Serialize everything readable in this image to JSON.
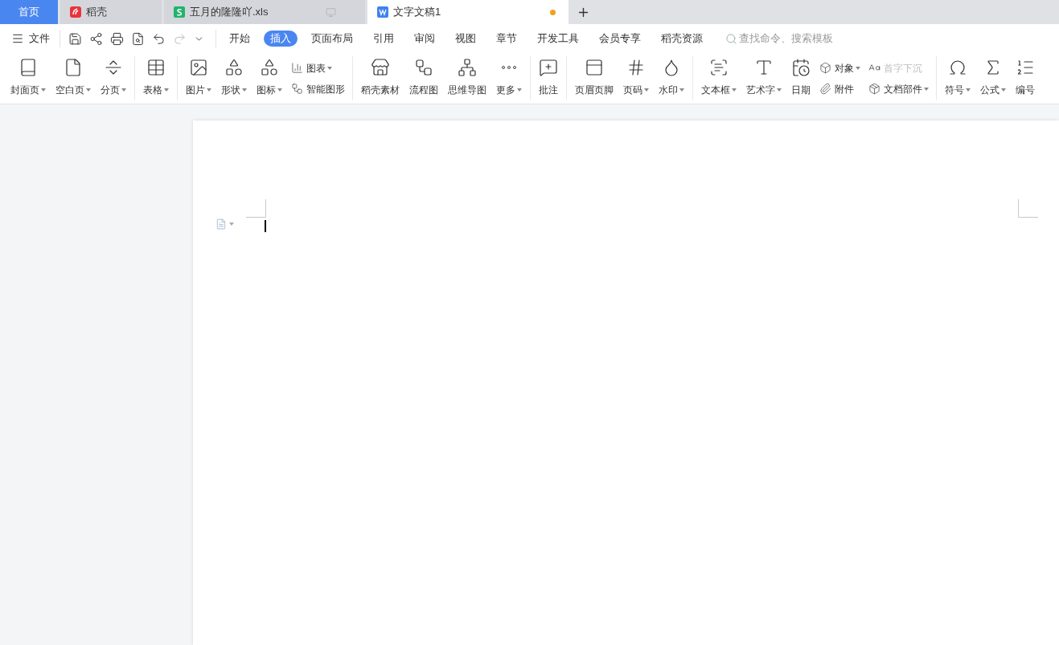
{
  "tabs": [
    {
      "label": "首页",
      "kind": "home",
      "selected": false,
      "unsaved": false
    },
    {
      "label": "稻壳",
      "kind": "docer",
      "selected": false,
      "unsaved": false
    },
    {
      "label": "五月的隆隆吖.xls",
      "kind": "sheet",
      "selected": false,
      "unsaved": false
    },
    {
      "label": "文字文稿1",
      "kind": "writer",
      "selected": true,
      "unsaved": true
    }
  ],
  "menu": {
    "file": "文件",
    "ribbon_tabs": [
      {
        "label": "开始",
        "selected": false
      },
      {
        "label": "插入",
        "selected": true
      },
      {
        "label": "页面布局",
        "selected": false
      },
      {
        "label": "引用",
        "selected": false
      },
      {
        "label": "审阅",
        "selected": false
      },
      {
        "label": "视图",
        "selected": false
      },
      {
        "label": "章节",
        "selected": false
      },
      {
        "label": "开发工具",
        "selected": false
      },
      {
        "label": "会员专享",
        "selected": false
      },
      {
        "label": "稻壳资源",
        "selected": false
      }
    ],
    "search": {
      "placeholder": "查找命令、搜索模板"
    }
  },
  "ribbon_groups": [
    [
      {
        "kind": "large",
        "label": "封面页",
        "dropdown": true
      },
      {
        "kind": "large",
        "label": "空白页",
        "dropdown": true
      },
      {
        "kind": "large",
        "label": "分页",
        "dropdown": true
      }
    ],
    [
      {
        "kind": "large",
        "label": "表格",
        "dropdown": true
      }
    ],
    [
      {
        "kind": "large",
        "label": "图片",
        "dropdown": true
      },
      {
        "kind": "large",
        "label": "形状",
        "dropdown": true
      },
      {
        "kind": "large",
        "label": "图标",
        "dropdown": true
      },
      {
        "kind": "stack",
        "items": [
          {
            "label": "图表",
            "dropdown": true,
            "disabled": false
          },
          {
            "label": "智能图形",
            "dropdown": false,
            "disabled": false
          }
        ]
      }
    ],
    [
      {
        "kind": "large",
        "label": "稻壳素材",
        "dropdown": false
      },
      {
        "kind": "large",
        "label": "流程图",
        "dropdown": false
      },
      {
        "kind": "large",
        "label": "思维导图",
        "dropdown": false
      },
      {
        "kind": "large",
        "label": "更多",
        "dropdown": true
      }
    ],
    [
      {
        "kind": "large",
        "label": "批注",
        "dropdown": false
      }
    ],
    [
      {
        "kind": "large",
        "label": "页眉页脚",
        "dropdown": false
      },
      {
        "kind": "large",
        "label": "页码",
        "dropdown": true
      },
      {
        "kind": "large",
        "label": "水印",
        "dropdown": true
      }
    ],
    [
      {
        "kind": "large",
        "label": "文本框",
        "dropdown": true
      },
      {
        "kind": "large",
        "label": "艺术字",
        "dropdown": true
      },
      {
        "kind": "large",
        "label": "日期",
        "dropdown": false
      },
      {
        "kind": "stack",
        "items": [
          {
            "label": "对象",
            "dropdown": true,
            "disabled": false
          },
          {
            "label": "附件",
            "dropdown": false,
            "disabled": false
          }
        ]
      },
      {
        "kind": "stack",
        "items": [
          {
            "label": "首字下沉",
            "dropdown": false,
            "disabled": true
          },
          {
            "label": "文档部件",
            "dropdown": true,
            "disabled": false
          }
        ]
      }
    ],
    [
      {
        "kind": "large",
        "label": "符号",
        "dropdown": true
      },
      {
        "kind": "large",
        "label": "公式",
        "dropdown": true
      },
      {
        "kind": "large",
        "label": "编号",
        "dropdown": false
      }
    ]
  ]
}
